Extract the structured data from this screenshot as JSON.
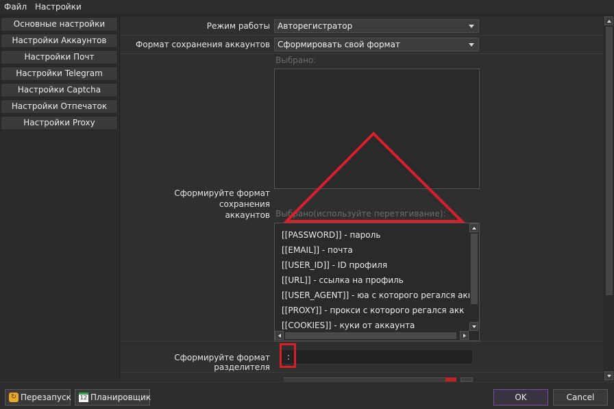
{
  "menu": {
    "file": "Файл",
    "settings": "Настройки"
  },
  "sidebar": {
    "items": [
      {
        "label": "Основные настройки"
      },
      {
        "label": "Настройки Аккаунтов"
      },
      {
        "label": "Настройки Почт"
      },
      {
        "label": "Настройки Telegram"
      },
      {
        "label": "Настройки Captcha"
      },
      {
        "label": "Настройки Отпечаток"
      },
      {
        "label": "Настройки Proxy"
      }
    ]
  },
  "form": {
    "mode_label": "Режим работы",
    "mode_value": "Авторегистратор",
    "save_format_label": "Формат сохранения аккаунтов",
    "save_format_value": "Сформировать свой формат",
    "selected_caption": "Выбрано:",
    "build_format_label_line1": "Сформируйте формат сохранения",
    "build_format_label_line2": "аккаунтов",
    "drag_caption": "Выбрано(используйте перетягивание):",
    "available_items": [
      "[[PASSWORD]] - пароль",
      "[[EMAIL]] - почта",
      "[[USER_ID]] - ID профиля",
      "[[URL]] - ссылка на профиль",
      "[[USER_AGENT]] - юа с которого регался акк",
      "[[PROXY]] - прокси с которого регался акк",
      "[[COOKIES]] - куки от аккаунта"
    ],
    "separator_label": "Сформируйте формат разделителя",
    "separator_value": ":"
  },
  "bottom": {
    "restart_label": "Перезапуск",
    "scheduler_label": "Планировщик",
    "scheduler_icon_text": "12",
    "ok_label": "OK",
    "cancel_label": "Cancel"
  },
  "colors": {
    "highlight_red": "#d9202a",
    "accent_purple": "#7a4fa0"
  }
}
